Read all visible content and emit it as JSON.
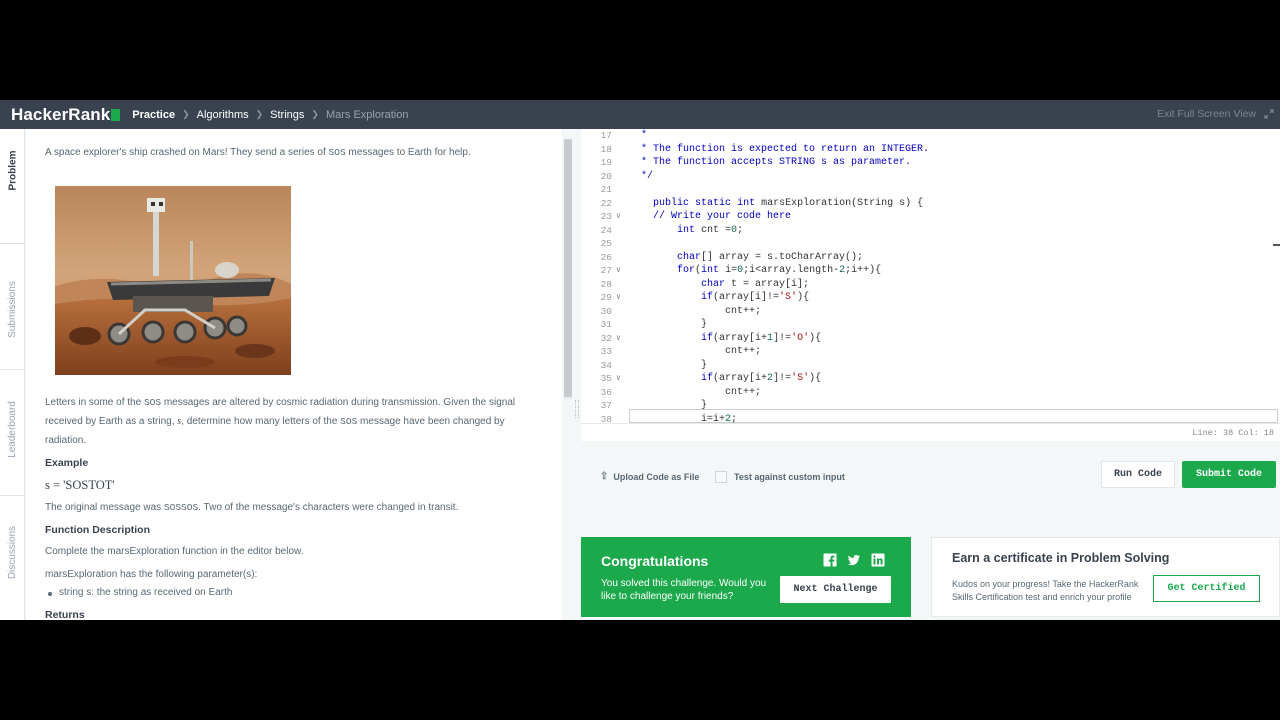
{
  "nav": {
    "logo": "HackerRank",
    "breadcrumbs": [
      "Practice",
      "Algorithms",
      "Strings",
      "Mars Exploration"
    ],
    "exit_label": "Exit Full Screen View"
  },
  "vtabs": [
    "Problem",
    "Submissions",
    "Leaderboard",
    "Discussions"
  ],
  "problem": {
    "intro_pre": "A space explorer's ship crashed on Mars! They send a series of ",
    "intro_code": "SOS",
    "intro_post": " messages to Earth for help.",
    "para1_a": "Letters in some of the ",
    "para1_code": "SOS",
    "para1_b": " messages are altered by cosmic radiation during transmission. Given the signal received by Earth as a string, ",
    "para1_var": "s",
    "para1_c": ", determine how many letters of the ",
    "para1_code2": "SOS",
    "para1_d": " message have been changed by radiation.",
    "example_heading": "Example",
    "example_math": "s = 'SOSTOT'",
    "original_a": "The original message was ",
    "original_code": "SOSSOS",
    "original_b": ". Two of the message's characters were changed in transit.",
    "func_heading": "Function Description",
    "func_text": "Complete the marsExploration function in the editor below.",
    "params_text": "marsExploration has the following parameter(s):",
    "param_item": "string s: the string as received on Earth",
    "returns_heading": "Returns"
  },
  "editor": {
    "lines": [
      {
        "n": "17",
        "fold": "",
        "html": "  <span class=\"cm\">*</span>"
      },
      {
        "n": "18",
        "fold": "",
        "html": "  <span class=\"cm\">* The function is expected to return an INTEGER.</span>"
      },
      {
        "n": "19",
        "fold": "",
        "html": "  <span class=\"cm\">* The function accepts STRING s as parameter.</span>"
      },
      {
        "n": "20",
        "fold": "",
        "html": "  <span class=\"cm\">*/</span>"
      },
      {
        "n": "21",
        "fold": "",
        "html": ""
      },
      {
        "n": "22",
        "fold": "",
        "html": "    <span class=\"kw\">public</span> <span class=\"kw\">static</span> <span class=\"kw\">int</span> marsExploration(String s) {"
      },
      {
        "n": "23",
        "fold": "v",
        "html": "    <span class=\"cm\">// Write your code here</span>"
      },
      {
        "n": "24",
        "fold": "",
        "html": "        <span class=\"kw\">int</span> cnt =<span class=\"num\">0</span>;"
      },
      {
        "n": "25",
        "fold": "",
        "html": ""
      },
      {
        "n": "26",
        "fold": "",
        "html": "        <span class=\"kw\">char</span>[] array = s.toCharArray();"
      },
      {
        "n": "27",
        "fold": "v",
        "html": "        <span class=\"kw\">for</span>(<span class=\"kw\">int</span> i=<span class=\"num\">0</span>;i&lt;array.length-<span class=\"num\">2</span>;i++){"
      },
      {
        "n": "28",
        "fold": "",
        "html": "            <span class=\"kw\">char</span> t = array[i];"
      },
      {
        "n": "29",
        "fold": "v",
        "html": "            <span class=\"kw\">if</span>(array[i]!=<span class=\"str\">'S'</span>){"
      },
      {
        "n": "30",
        "fold": "",
        "html": "                cnt++;"
      },
      {
        "n": "31",
        "fold": "",
        "html": "            }"
      },
      {
        "n": "32",
        "fold": "v",
        "html": "            <span class=\"kw\">if</span>(array[i+<span class=\"num\">1</span>]!=<span class=\"str\">'O'</span>){"
      },
      {
        "n": "33",
        "fold": "",
        "html": "                cnt++;"
      },
      {
        "n": "34",
        "fold": "",
        "html": "            }"
      },
      {
        "n": "35",
        "fold": "v",
        "html": "            <span class=\"kw\">if</span>(array[i+<span class=\"num\">2</span>]!=<span class=\"str\">'S'</span>){"
      },
      {
        "n": "36",
        "fold": "",
        "html": "                cnt++;"
      },
      {
        "n": "37",
        "fold": "",
        "html": "            }"
      },
      {
        "n": "38",
        "fold": "",
        "html": "            i=i+<span class=\"num\">2</span>;"
      }
    ],
    "status": "Line: 38 Col: 18"
  },
  "actions": {
    "upload_label": "Upload Code as File",
    "custom_input_label": "Test against custom input",
    "run_label": "Run Code",
    "submit_label": "Submit Code"
  },
  "congrats": {
    "title": "Congratulations",
    "text": "You solved this challenge. Would you like to challenge your friends?",
    "button": "Next Challenge",
    "social_icons": [
      "facebook-icon",
      "twitter-icon",
      "linkedin-icon"
    ]
  },
  "certificate": {
    "title": "Earn a certificate in Problem Solving",
    "text": "Kudos on your progress! Take the HackerRank Skills Certification test and enrich your profile",
    "button": "Get Certified"
  },
  "colors": {
    "nav_bg": "#39424e",
    "brand_green": "#1ba94c",
    "page_bg": "#f3f7f7"
  }
}
